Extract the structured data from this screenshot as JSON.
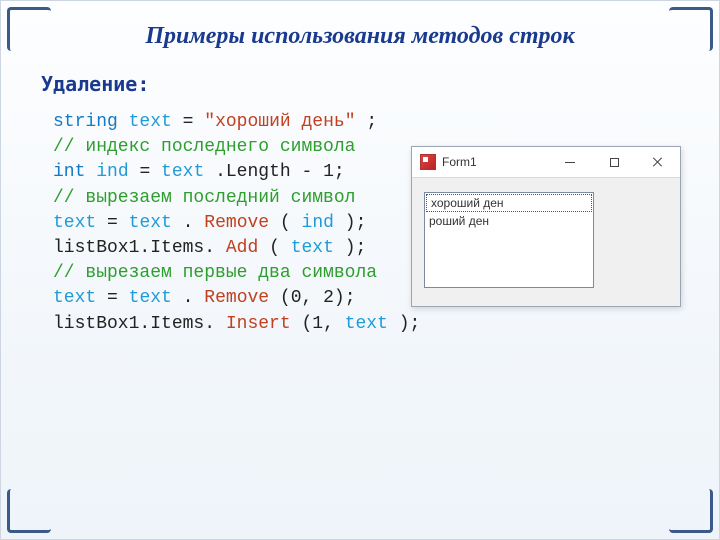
{
  "title": "Примеры использования методов строк",
  "subtitle": "Удаление:",
  "code": {
    "l1_kw": "string",
    "l1_var": "text",
    "l1_eq": " = ",
    "l1_str": "\"хороший день\"",
    "l1_sc": ";",
    "l2_cm": "// индекс последнего символа",
    "l3_kw": "int",
    "l3_var": "ind",
    "l3_rest_a": " = ",
    "l3_text": "text",
    "l3_rest_b": ".Length - 1;",
    "l4_cm": "// вырезаем последний символ",
    "l5_a": "text",
    "l5_eq": " = ",
    "l5_t2": "text",
    "l5_dot": ".",
    "l5_fn": "Remove",
    "l5_p": "(",
    "l5_arg": "ind",
    "l5_end": ");",
    "l6_a": "listBox1.Items.",
    "l6_fn": "Add",
    "l6_p": "(",
    "l6_arg": "text",
    "l6_end": ");",
    "l7_cm": "// вырезаем первые два символа",
    "l8_a": "text",
    "l8_eq": " = ",
    "l8_t2": "text",
    "l8_dot": ".",
    "l8_fn": "Remove",
    "l8_args": "(0, 2);",
    "l9_a": "listBox1.Items.",
    "l9_fn": "Insert",
    "l9_p": "(1, ",
    "l9_arg": "text",
    "l9_end": ");"
  },
  "form": {
    "title": "Form1",
    "list": {
      "item0": "хороший ден",
      "item1": "роший ден"
    }
  }
}
